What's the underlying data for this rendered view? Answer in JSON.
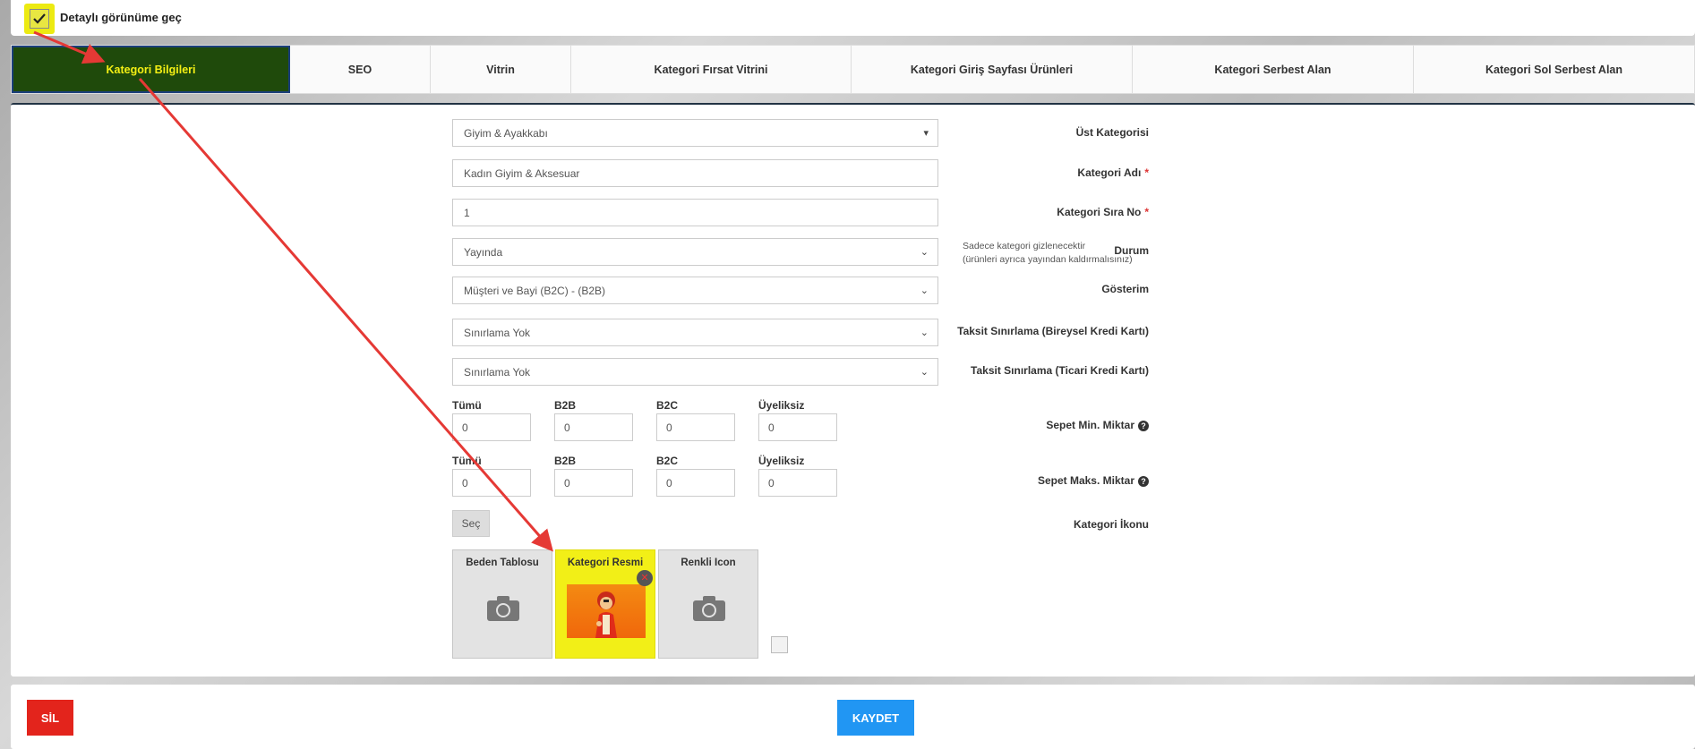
{
  "top": {
    "detail_view_label": "Detaylı görünüme geç",
    "checked": true
  },
  "tabs": [
    {
      "label": "Kategori Bilgileri",
      "active": true
    },
    {
      "label": "SEO"
    },
    {
      "label": "Vitrin"
    },
    {
      "label": "Kategori Fırsat Vitrini"
    },
    {
      "label": "Kategori Giriş Sayfası Ürünleri"
    },
    {
      "label": "Kategori Serbest Alan"
    },
    {
      "label": "Kategori Sol Serbest Alan"
    }
  ],
  "form": {
    "parent": {
      "label": "Üst Kategorisi",
      "value": "Giyim & Ayakkabı"
    },
    "name": {
      "label": "Kategori Adı",
      "value": "Kadın Giyim & Aksesuar"
    },
    "order": {
      "label": "Kategori Sıra No",
      "value": "1"
    },
    "status": {
      "label": "Durum",
      "value": "Yayında",
      "note_line1": "Sadece kategori gizlenecektir",
      "note_line2": "(ürünleri ayrıca yayından kaldırmalısınız)"
    },
    "display": {
      "label": "Gösterim",
      "value": "Müşteri ve Bayi (B2C) - (B2B)"
    },
    "installment_personal": {
      "label": "Taksit Sınırlama (Bireysel Kredi Kartı)",
      "value": "Sınırlama Yok"
    },
    "installment_commercial": {
      "label": "Taksit Sınırlama (Ticari Kredi Kartı)",
      "value": "Sınırlama Yok"
    },
    "cart_min": {
      "label": "Sepet Min. Miktar",
      "cols": [
        "Tümü",
        "B2B",
        "B2C",
        "Üyeliksiz"
      ],
      "values": [
        "0",
        "0",
        "0",
        "0"
      ]
    },
    "cart_max": {
      "label": "Sepet Maks. Miktar",
      "cols": [
        "Tümü",
        "B2B",
        "B2C",
        "Üyeliksiz"
      ],
      "values": [
        "0",
        "0",
        "0",
        "0"
      ]
    },
    "icon": {
      "label": "Kategori İkonu",
      "button": "Seç"
    },
    "images": [
      {
        "title": "Beden Tablosu",
        "filled": false
      },
      {
        "title": "Kategori Resmi",
        "filled": true,
        "highlight": true
      },
      {
        "title": "Renkli Icon",
        "filled": false
      }
    ]
  },
  "footer": {
    "delete": "SİL",
    "save": "KAYDET"
  },
  "colors": {
    "active_tab_bg": "#1f4a0b",
    "active_tab_text": "#f4ef14",
    "highlight": "#f2ef17",
    "delete": "#e3241c",
    "save": "#2196f3",
    "arrow": "#e53935"
  }
}
